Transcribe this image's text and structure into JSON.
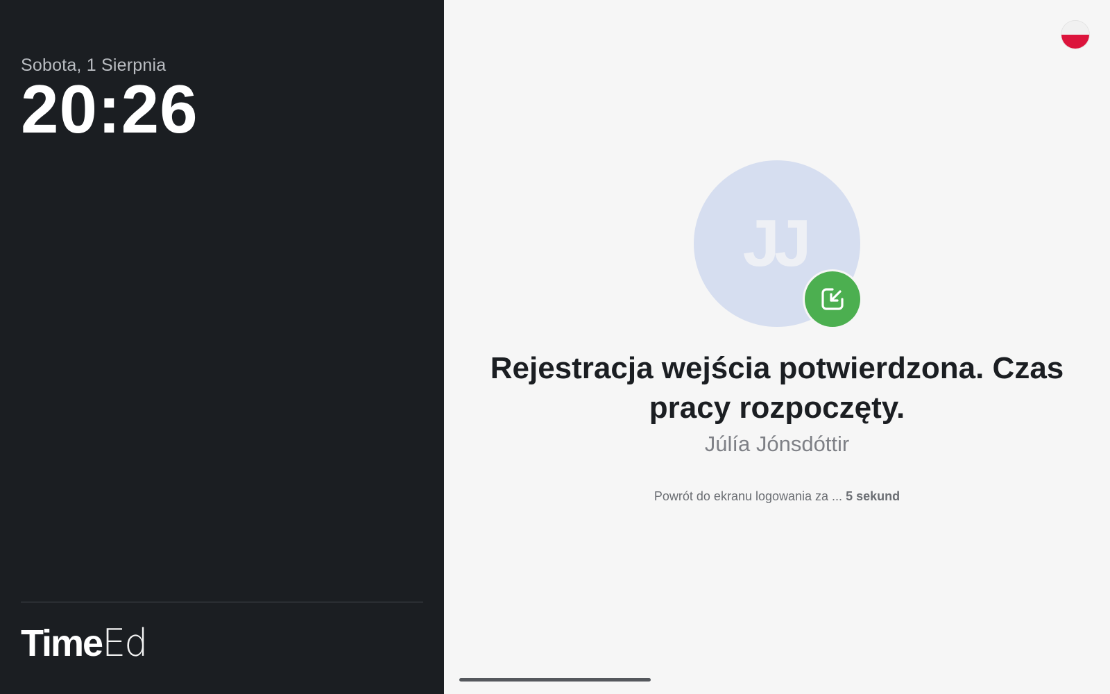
{
  "clock_panel": {
    "date": "Sobota, 1 Sierpnia",
    "time": "20:26"
  },
  "brand": {
    "logo_bold": "Time",
    "logo_thin": "Ed"
  },
  "language": {
    "flag_icon": "poland-flag-icon"
  },
  "confirmation": {
    "avatar_initials": "JJ",
    "badge_icon": "clock-in-arrow-icon",
    "badge_color": "#4caf50",
    "message": "Rejestracja wejścia potwierdzona. Czas pracy rozpoczęty.",
    "user_name": "Júlía Jónsdóttir",
    "countdown_prefix": "Powrót do ekranu logowania za ...",
    "countdown_value": "5 sekund"
  },
  "colors": {
    "left_panel_bg": "#1b1e22",
    "right_panel_bg": "#f6f6f6",
    "avatar_bg": "#d6def0"
  }
}
